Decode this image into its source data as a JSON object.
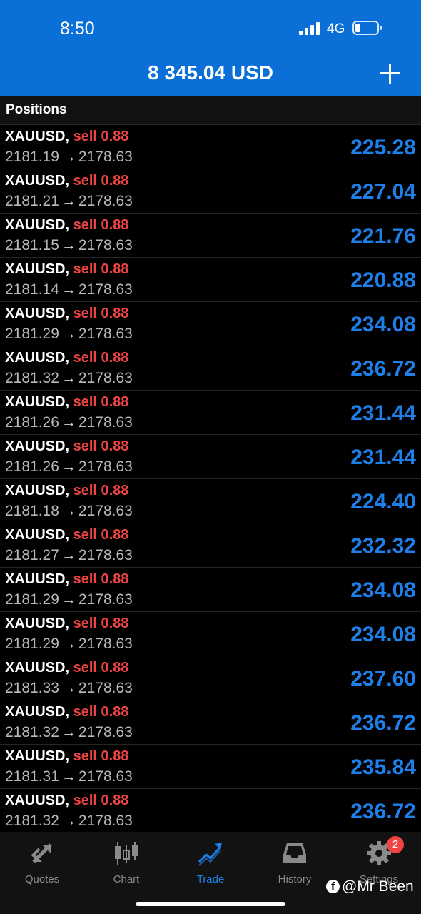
{
  "status_bar": {
    "time": "8:50",
    "network": "4G"
  },
  "header": {
    "balance": "8 345.04 USD",
    "add_icon": "plus-icon"
  },
  "section": {
    "title": "Positions"
  },
  "positions": [
    {
      "symbol": "XAUUSD",
      "side": "sell 0.88",
      "open": "2181.19",
      "current": "2178.63",
      "profit": "225.28"
    },
    {
      "symbol": "XAUUSD",
      "side": "sell 0.88",
      "open": "2181.21",
      "current": "2178.63",
      "profit": "227.04"
    },
    {
      "symbol": "XAUUSD",
      "side": "sell 0.88",
      "open": "2181.15",
      "current": "2178.63",
      "profit": "221.76"
    },
    {
      "symbol": "XAUUSD",
      "side": "sell 0.88",
      "open": "2181.14",
      "current": "2178.63",
      "profit": "220.88"
    },
    {
      "symbol": "XAUUSD",
      "side": "sell 0.88",
      "open": "2181.29",
      "current": "2178.63",
      "profit": "234.08"
    },
    {
      "symbol": "XAUUSD",
      "side": "sell 0.88",
      "open": "2181.32",
      "current": "2178.63",
      "profit": "236.72"
    },
    {
      "symbol": "XAUUSD",
      "side": "sell 0.88",
      "open": "2181.26",
      "current": "2178.63",
      "profit": "231.44"
    },
    {
      "symbol": "XAUUSD",
      "side": "sell 0.88",
      "open": "2181.26",
      "current": "2178.63",
      "profit": "231.44"
    },
    {
      "symbol": "XAUUSD",
      "side": "sell 0.88",
      "open": "2181.18",
      "current": "2178.63",
      "profit": "224.40"
    },
    {
      "symbol": "XAUUSD",
      "side": "sell 0.88",
      "open": "2181.27",
      "current": "2178.63",
      "profit": "232.32"
    },
    {
      "symbol": "XAUUSD",
      "side": "sell 0.88",
      "open": "2181.29",
      "current": "2178.63",
      "profit": "234.08"
    },
    {
      "symbol": "XAUUSD",
      "side": "sell 0.88",
      "open": "2181.29",
      "current": "2178.63",
      "profit": "234.08"
    },
    {
      "symbol": "XAUUSD",
      "side": "sell 0.88",
      "open": "2181.33",
      "current": "2178.63",
      "profit": "237.60"
    },
    {
      "symbol": "XAUUSD",
      "side": "sell 0.88",
      "open": "2181.32",
      "current": "2178.63",
      "profit": "236.72"
    },
    {
      "symbol": "XAUUSD",
      "side": "sell 0.88",
      "open": "2181.31",
      "current": "2178.63",
      "profit": "235.84"
    },
    {
      "symbol": "XAUUSD",
      "side": "sell 0.88",
      "open": "2181.32",
      "current": "2178.63",
      "profit": "236.72"
    }
  ],
  "tabs": [
    {
      "label": "Quotes",
      "icon": "quotes-arrows-icon"
    },
    {
      "label": "Chart",
      "icon": "candlestick-chart-icon"
    },
    {
      "label": "Trade",
      "icon": "trade-trend-icon",
      "active": true
    },
    {
      "label": "History",
      "icon": "inbox-tray-icon"
    },
    {
      "label": "Settings",
      "icon": "gear-icon"
    }
  ],
  "settings_badge": "2",
  "watermark": {
    "text": "@Mr Been",
    "icon": "facebook-icon"
  },
  "colors": {
    "header_bg": "#0a6fd6",
    "profit": "#1e7fe8",
    "sell": "#ef4444",
    "background": "#000000"
  }
}
